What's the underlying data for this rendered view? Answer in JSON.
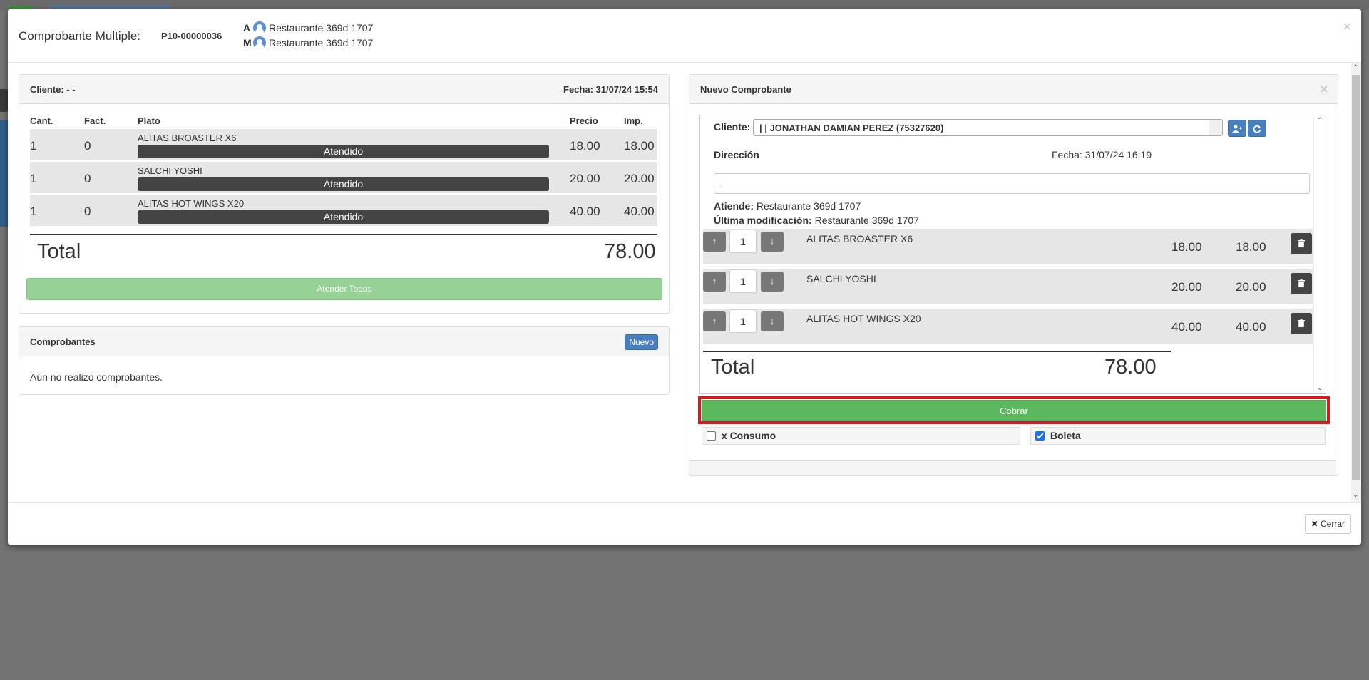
{
  "modal": {
    "title": "Comprobante Multiple:",
    "code": "P10-00000036",
    "staff": [
      {
        "letter": "A",
        "name": "Restaurante 369d 1707"
      },
      {
        "letter": "M",
        "name": "Restaurante 369d 1707"
      }
    ],
    "close_icon": "×"
  },
  "order": {
    "cliente": "Cliente: - -",
    "fecha": "Fecha: 31/07/24 15:54",
    "headers": {
      "cant": "Cant.",
      "fact": "Fact.",
      "plato": "Plato",
      "precio": "Precio",
      "imp": "Imp."
    },
    "rows": [
      {
        "cant": "1",
        "fact": "0",
        "plato": "ALITAS BROASTER X6",
        "status": "Atendido",
        "precio": "18.00",
        "imp": "18.00"
      },
      {
        "cant": "1",
        "fact": "0",
        "plato": "SALCHI YOSHI",
        "status": "Atendido",
        "precio": "20.00",
        "imp": "20.00"
      },
      {
        "cant": "1",
        "fact": "0",
        "plato": "ALITAS HOT WINGS X20",
        "status": "Atendido",
        "precio": "40.00",
        "imp": "40.00"
      }
    ],
    "total_label": "Total",
    "total_value": "78.00",
    "atender_label": "Atender Todos"
  },
  "comprobantes": {
    "title": "Comprobantes",
    "nuevo_label": "Nuevo",
    "empty_text": "Aún no realizó comprobantes."
  },
  "nuevo": {
    "title": "Nuevo Comprobante",
    "close_icon": "×",
    "cliente_label": "Cliente:",
    "cliente_value": "| | JONATHAN DAMIAN PEREZ (75327620)",
    "direccion_label": "Dirección",
    "fecha": "Fecha: 31/07/24 16:19",
    "direccion_value": "-",
    "atiende_label": "Atiende:",
    "atiende_value": "Restaurante 369d 1707",
    "ultima_label": "Última modificación:",
    "ultima_value": "Restaurante 369d 1707",
    "items": [
      {
        "qty": "1",
        "name": "ALITAS BROASTER X6",
        "precio": "18.00",
        "imp": "18.00"
      },
      {
        "qty": "1",
        "name": "SALCHI YOSHI",
        "precio": "20.00",
        "imp": "20.00"
      },
      {
        "qty": "1",
        "name": "ALITAS HOT WINGS X20",
        "precio": "40.00",
        "imp": "40.00"
      }
    ],
    "total_label": "Total",
    "total_value": "78.00",
    "cobrar_label": "Cobrar",
    "consumo_label": "x Consumo",
    "consumo_checked": false,
    "boleta_label": "Boleta",
    "boleta_checked": true
  },
  "footer": {
    "cerrar_label": "Cerrar",
    "cerrar_icon": "✖"
  }
}
